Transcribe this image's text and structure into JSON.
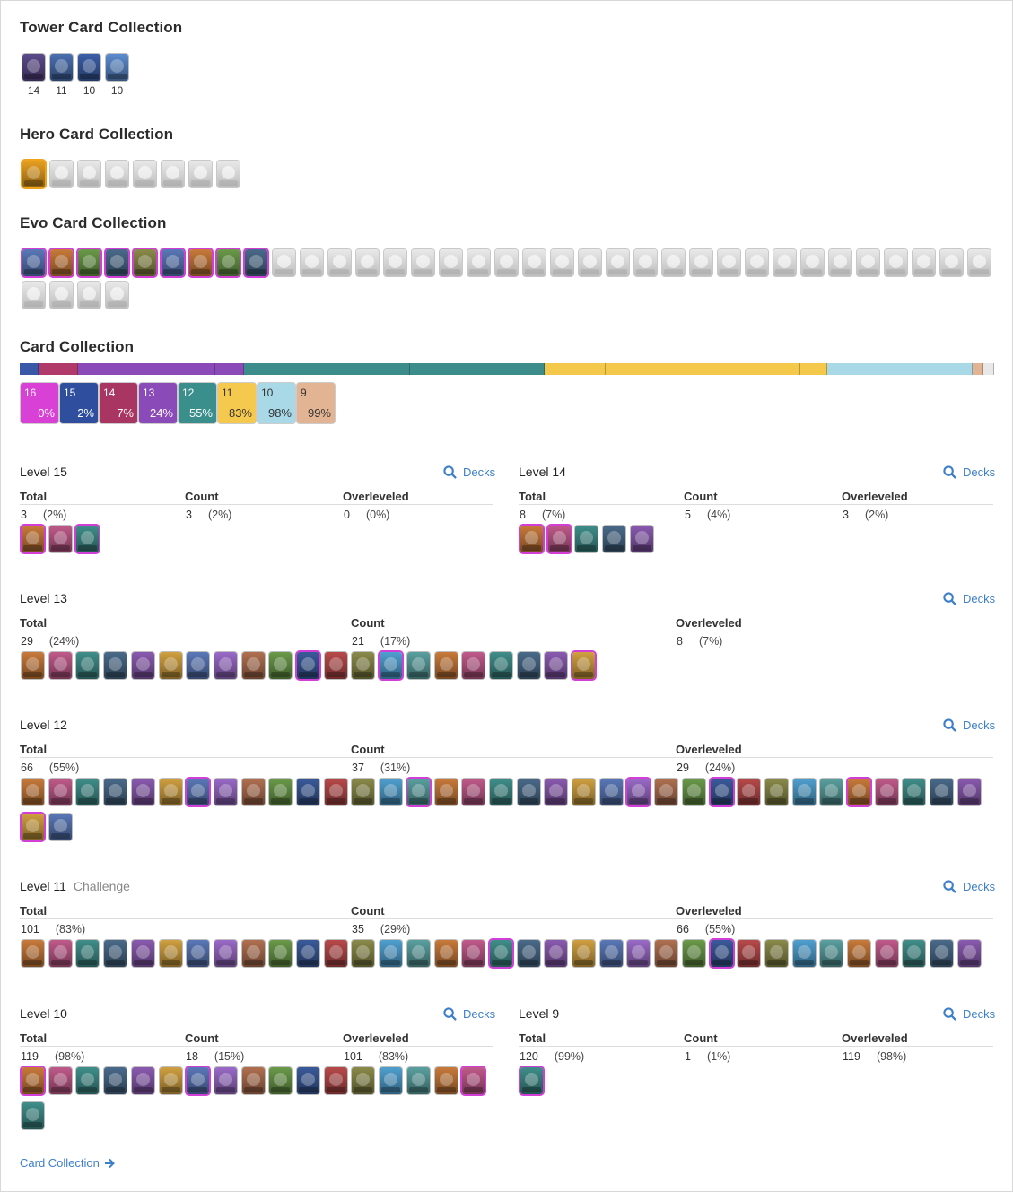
{
  "tower": {
    "title": "Tower Card Collection",
    "levels": [
      "14",
      "11",
      "10",
      "10"
    ],
    "colors": [
      "#5b4a8a",
      "#4a6fb0",
      "#3c5fa8",
      "#5c8ccf"
    ]
  },
  "hero": {
    "title": "Hero Card Collection"
  },
  "evo": {
    "title": "Evo Card Collection"
  },
  "collection": {
    "title": "Card Collection",
    "bar": [
      {
        "color": "#3a58a8",
        "frac": 0.019
      },
      {
        "color": "#b03a6a",
        "frac": 0.041
      },
      {
        "color": "#8a4ab8",
        "frac": 0.141
      },
      {
        "color": "#8a4ab8",
        "frac": 0.029
      },
      {
        "color": "#3d8c8c",
        "frac": 0.171
      },
      {
        "color": "#3d8c8c",
        "frac": 0.138
      },
      {
        "color": "#f4c84a",
        "frac": 0.062
      },
      {
        "color": "#f4c84a",
        "frac": 0.2
      },
      {
        "color": "#f4c84a",
        "frac": 0.028
      },
      {
        "color": "#a9d8e6",
        "frac": 0.149
      },
      {
        "color": "#e3b493",
        "frac": 0.011
      },
      {
        "color": "#e8e8e8",
        "frac": 0.011
      }
    ],
    "chips": [
      {
        "level": "16",
        "pct": "0%",
        "color": "#d940d6",
        "text": "#fff"
      },
      {
        "level": "15",
        "pct": "2%",
        "color": "#2f4f9e",
        "text": "#fff"
      },
      {
        "level": "14",
        "pct": "7%",
        "color": "#a83562",
        "text": "#fff"
      },
      {
        "level": "13",
        "pct": "24%",
        "color": "#8a4ab8",
        "text": "#fff"
      },
      {
        "level": "12",
        "pct": "55%",
        "color": "#3a8f8c",
        "text": "#fff"
      },
      {
        "level": "11",
        "pct": "83%",
        "color": "#f5c94e",
        "text": "#333"
      },
      {
        "level": "10",
        "pct": "98%",
        "color": "#a9d8e6",
        "text": "#333"
      },
      {
        "level": "9",
        "pct": "99%",
        "color": "#e3b493",
        "text": "#333"
      }
    ]
  },
  "labels": {
    "total": "Total",
    "count": "Count",
    "overleveled": "Overleveled",
    "decks": "Decks"
  },
  "sections": {
    "l15": {
      "title": "Level 15",
      "total": "3",
      "total_pct": "(2%)",
      "count": "3",
      "count_pct": "(2%)",
      "over": "0",
      "over_pct": "(0%)"
    },
    "l14": {
      "title": "Level 14",
      "total": "8",
      "total_pct": "(7%)",
      "count": "5",
      "count_pct": "(4%)",
      "over": "3",
      "over_pct": "(2%)"
    },
    "l13": {
      "title": "Level 13",
      "total": "29",
      "total_pct": "(24%)",
      "count": "21",
      "count_pct": "(17%)",
      "over": "8",
      "over_pct": "(7%)"
    },
    "l12": {
      "title": "Level 12",
      "total": "66",
      "total_pct": "(55%)",
      "count": "37",
      "count_pct": "(31%)",
      "over": "29",
      "over_pct": "(24%)"
    },
    "l11": {
      "title": "Level 11",
      "subtitle": "Challenge",
      "total": "101",
      "total_pct": "(83%)",
      "count": "35",
      "count_pct": "(29%)",
      "over": "66",
      "over_pct": "(55%)"
    },
    "l10": {
      "title": "Level 10",
      "total": "119",
      "total_pct": "(98%)",
      "count": "18",
      "count_pct": "(15%)",
      "over": "101",
      "over_pct": "(83%)"
    },
    "l9": {
      "title": "Level 9",
      "total": "120",
      "total_pct": "(99%)",
      "count": "1",
      "count_pct": "(1%)",
      "over": "119",
      "over_pct": "(98%)"
    }
  },
  "footer_link": "Card Collection",
  "palette": [
    "#5a78b8",
    "#8a5ab0",
    "#3f8e8a",
    "#c87a3a",
    "#4fa0d0",
    "#b84a4a",
    "#6a9a4a",
    "#9a6ac8",
    "#d0a040",
    "#4a6a8a",
    "#c05a8a",
    "#5aa0a0",
    "#8a8a4a",
    "#3a5a9a",
    "#b07050"
  ]
}
